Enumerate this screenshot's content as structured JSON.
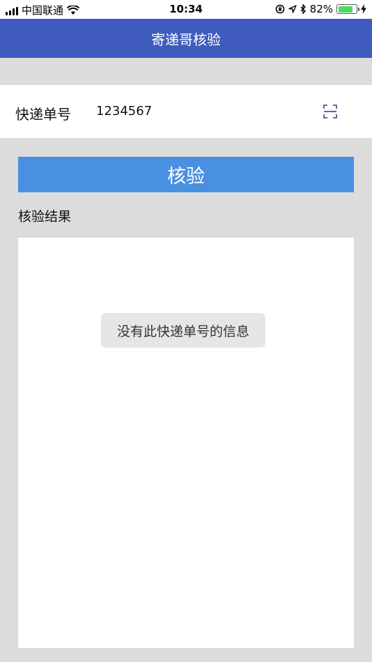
{
  "status_bar": {
    "carrier": "中国联通",
    "time": "10:34",
    "battery_percent": "82%",
    "battery_level": 0.82,
    "icons": [
      "signal-icon",
      "wifi-icon",
      "orientation-lock-icon",
      "location-icon",
      "bluetooth-icon",
      "battery-icon",
      "charging-icon"
    ]
  },
  "nav": {
    "title": "寄递哥核验"
  },
  "form": {
    "tracking_label": "快递单号",
    "tracking_value": "1234567",
    "scan_icon": "scan-icon"
  },
  "verify_button": {
    "label": "核验"
  },
  "result": {
    "title": "核验结果",
    "toast": "没有此快递单号的信息"
  },
  "colors": {
    "nav_bg": "#3f5bbd",
    "button_bg": "#4a90e2",
    "page_bg": "#dcdcdc",
    "battery_fill": "#4cd964"
  }
}
